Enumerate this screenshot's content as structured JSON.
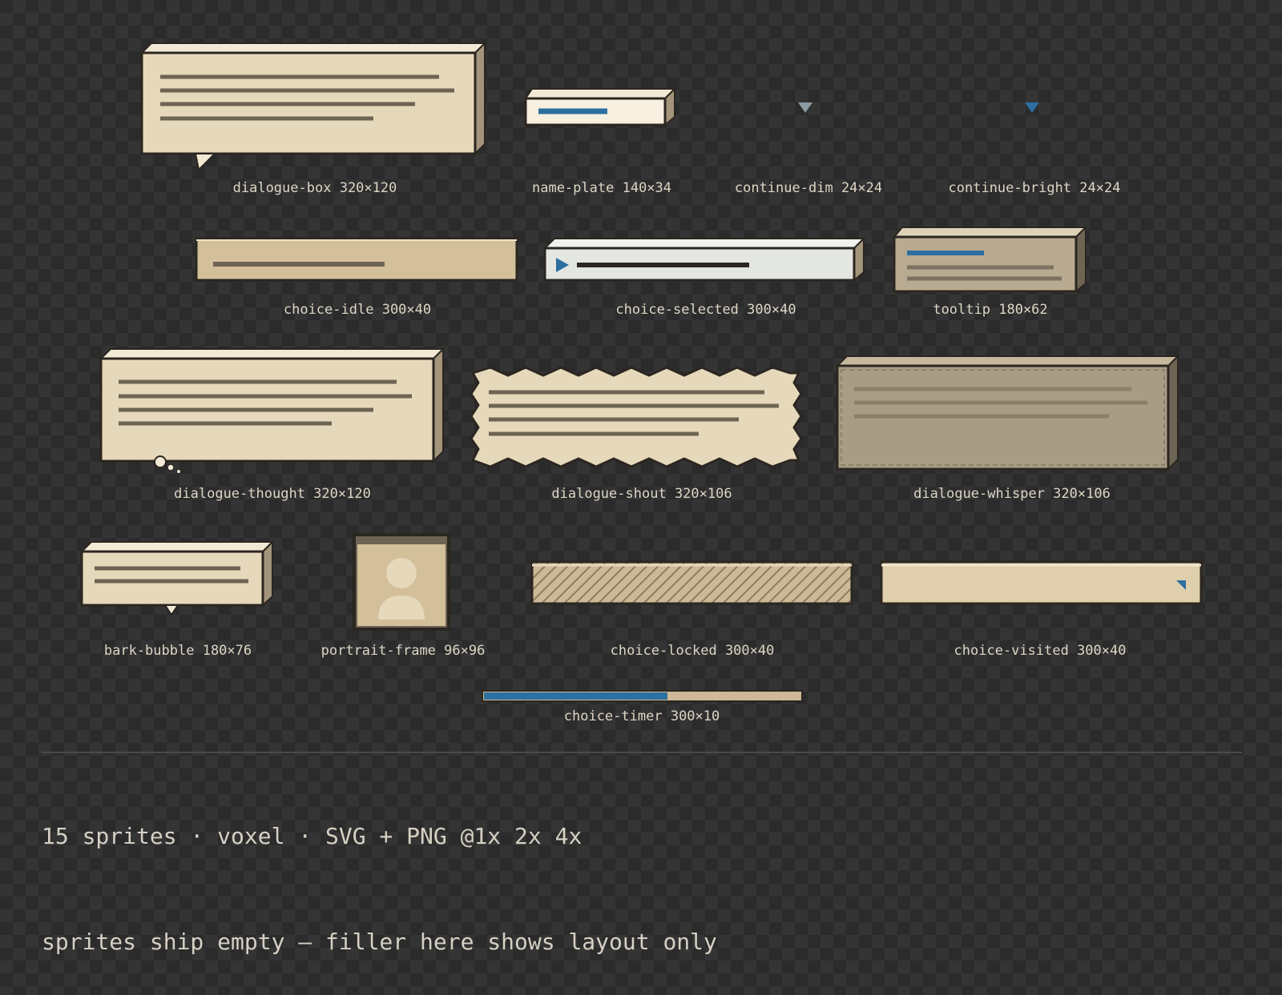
{
  "sprites": [
    {
      "name": "dialogue-box",
      "size": "320×120"
    },
    {
      "name": "name-plate",
      "size": "140×34"
    },
    {
      "name": "continue-dim",
      "size": "24×24"
    },
    {
      "name": "continue-bright",
      "size": "24×24"
    },
    {
      "name": "choice-idle",
      "size": "300×40"
    },
    {
      "name": "choice-selected",
      "size": "300×40"
    },
    {
      "name": "tooltip",
      "size": "180×62"
    },
    {
      "name": "dialogue-thought",
      "size": "320×120"
    },
    {
      "name": "dialogue-shout",
      "size": "320×106"
    },
    {
      "name": "dialogue-whisper",
      "size": "320×106"
    },
    {
      "name": "bark-bubble",
      "size": "180×76"
    },
    {
      "name": "portrait-frame",
      "size": "96×96"
    },
    {
      "name": "choice-locked",
      "size": "300×40"
    },
    {
      "name": "choice-visited",
      "size": "300×40"
    },
    {
      "name": "choice-timer",
      "size": "300×10"
    }
  ],
  "timer_fill_fraction": 0.58,
  "footer": {
    "line1": "15 sprites · voxel · SVG + PNG @1x 2x 4x",
    "line2": "sprites ship empty — filler here shows layout only"
  },
  "colors": {
    "panel": "#e6d8ba",
    "panel_dark": "#d3bf9a",
    "outline": "#2b2620",
    "filler": "#6e6453",
    "accent_blue": "#2c6fa0",
    "selected": "#e3e6e1",
    "whisper": "#a89c84"
  }
}
